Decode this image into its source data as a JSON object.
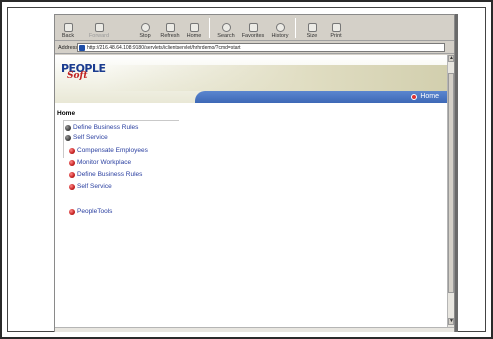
{
  "toolbar": {
    "buttons": [
      {
        "label": "Back",
        "enabled": true
      },
      {
        "label": "Forward",
        "enabled": false
      },
      {
        "label": "Stop",
        "enabled": true
      },
      {
        "label": "Refresh",
        "enabled": true
      },
      {
        "label": "Home",
        "enabled": true
      },
      {
        "label": "Search",
        "enabled": true
      },
      {
        "label": "Favorites",
        "enabled": true
      },
      {
        "label": "History",
        "enabled": true
      },
      {
        "label": "Size",
        "enabled": true
      },
      {
        "label": "Print",
        "enabled": true
      }
    ]
  },
  "address": {
    "label": "Address",
    "url": "http://216.48.64.108:9180/servlets/iclientservlet/hrhrdemo/?cmd=start"
  },
  "app": {
    "logo_top": "PEOPLE",
    "logo_bottom": "Soft",
    "home_link": "Home",
    "page_title": "Home"
  },
  "menu": {
    "top_items": [
      {
        "label": "Define Business Rules",
        "icon": "expand-bullet-icon"
      },
      {
        "label": "Self Service",
        "icon": "collapse-bullet-icon"
      }
    ],
    "sub_items": [
      {
        "label": "Compensate Employees"
      },
      {
        "label": "Monitor Workplace"
      },
      {
        "label": "Define Business Rules"
      },
      {
        "label": "Self Service"
      }
    ],
    "tools": {
      "label": "PeopleTools"
    }
  },
  "colors": {
    "link": "#2a3fa0",
    "home_band": "#4a74c0",
    "bullet": "#c52020"
  }
}
